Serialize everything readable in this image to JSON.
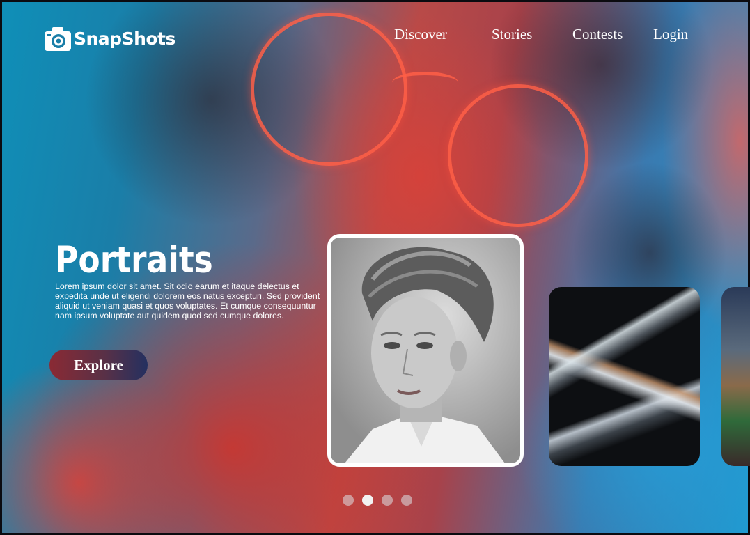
{
  "brand": {
    "name": "SnapShots",
    "icon": "camera-icon"
  },
  "nav": {
    "items": [
      {
        "label": "Discover"
      },
      {
        "label": "Stories"
      },
      {
        "label": "Contests"
      },
      {
        "label": "Login"
      }
    ]
  },
  "hero": {
    "title": "Portraits",
    "description": "Lorem ipsum dolor sit amet. Sit odio earum et itaque delectus et expedita unde ut eligendi dolorem eos natus excepturi. Sed provident aliquid ut veniam quasi et quos voluptates. Et cumque consequuntur nam ipsum voluptate aut quidem quod sed cumque dolores.",
    "cta_label": "Explore"
  },
  "carousel": {
    "slides": [
      {
        "name": "black-and-white-portrait"
      },
      {
        "name": "abstract-liquid-metal"
      },
      {
        "name": "stadium-crowd"
      }
    ],
    "dots_total": 4,
    "active_dot": 2
  },
  "colors": {
    "button_gradient_start": "#8a2a34",
    "button_gradient_end": "#243060",
    "text": "#ffffff",
    "card_border": "#ffffff"
  }
}
